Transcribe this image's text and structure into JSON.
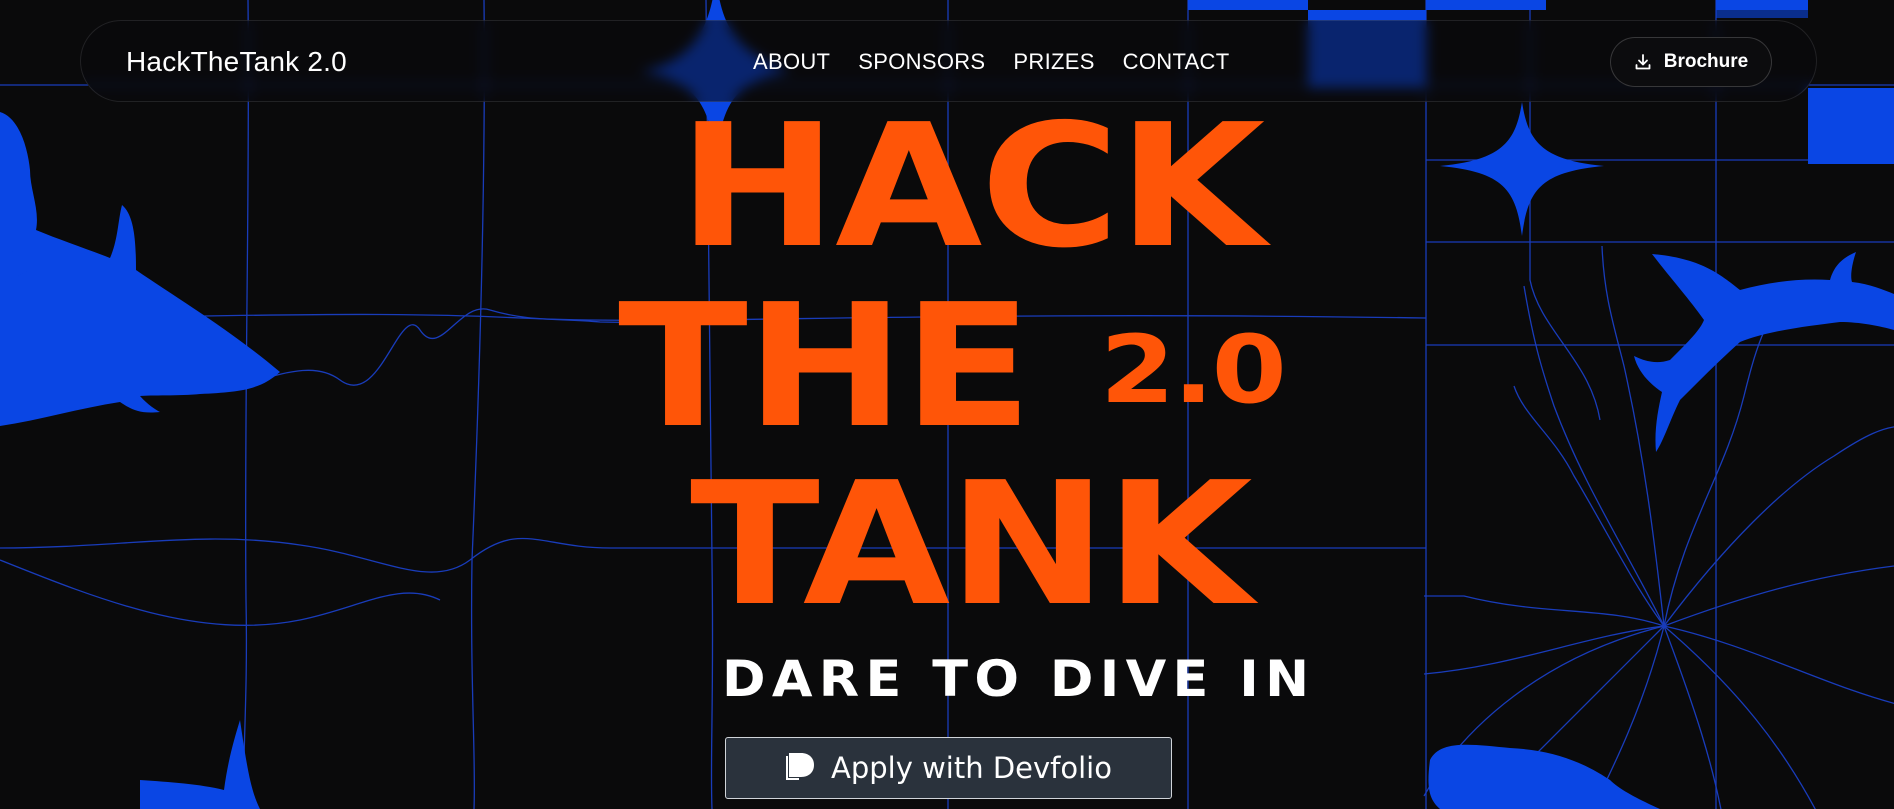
{
  "nav": {
    "brand": "HackTheTank 2.0",
    "links": [
      "ABOUT",
      "SPONSORS",
      "PRIZES",
      "CONTACT"
    ],
    "brochure_label": "Brochure",
    "brochure_icon": "download-icon"
  },
  "hero": {
    "line1": "HACK",
    "line2": "THE",
    "version": "2.0",
    "line3": "TANK",
    "tagline": "DARE TO DIVE IN",
    "apply_label": "Apply with Devfolio",
    "apply_icon": "devfolio-logo-icon"
  },
  "colors": {
    "background": "#0a0a0b",
    "accent_orange": "#ff5508",
    "accent_blue": "#0a46e4",
    "grid_line": "#1a3fc4",
    "button_bg": "#2a323c"
  }
}
